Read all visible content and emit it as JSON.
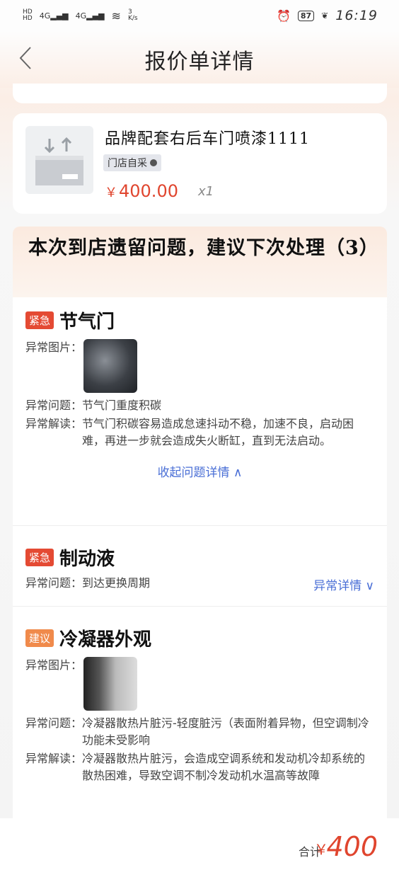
{
  "status_bar": {
    "hd1": "HD",
    "hd2": "HD",
    "net1": "4G",
    "net2": "4G",
    "speed_value": "3",
    "speed_unit": "K/s",
    "battery": "87",
    "time": "16:19"
  },
  "nav": {
    "title": "报价单详情"
  },
  "product": {
    "name": "品牌配套右后车门喷漆1111",
    "tag": "门店自采",
    "price_symbol": "￥",
    "price": "400.00",
    "qty": "x1"
  },
  "issues_section": {
    "title": "本次到店遗留问题，建议下次处理（3）",
    "items": [
      {
        "badge": "紧急",
        "badge_type": "urgent",
        "name": "节气门",
        "photo_label": "异常图片：",
        "problem_label": "异常问题：",
        "problem": "节气门重度积碳",
        "explain_label": "异常解读：",
        "explain": "节气门积碳容易造成怠速抖动不稳，加速不良，启动困难，再进一步就会造成失火断缸，直到无法启动。",
        "collapse_label": "收起问题详情 ∧"
      },
      {
        "badge": "紧急",
        "badge_type": "urgent",
        "name": "制动液",
        "problem_label": "异常问题：",
        "problem": "到达更换周期",
        "detail_label": "异常详情 ∨"
      },
      {
        "badge": "建议",
        "badge_type": "suggest",
        "name": "冷凝器外观",
        "photo_label": "异常图片：",
        "problem_label": "异常问题：",
        "problem": "冷凝器散热片脏污-轻度脏污（表面附着异物，但空调制冷功能未受影响",
        "explain_label": "异常解读：",
        "explain": "冷凝器散热片脏污，会造成空调系统和发动机冷却系统的散热困难，导致空调不制冷发动机水温高等故障"
      }
    ]
  },
  "bottom": {
    "total_label": "合计",
    "total_symbol": "￥",
    "total_value": "400"
  },
  "colors": {
    "accent_red": "#e0452e",
    "link_blue": "#4a6fd6",
    "urgent": "#e44a33",
    "suggest": "#f08a4b"
  }
}
